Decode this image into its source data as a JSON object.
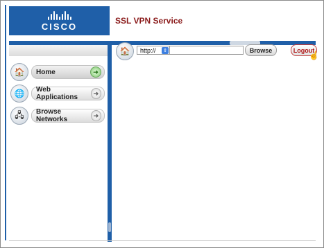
{
  "header": {
    "logo_text": "CISCO",
    "title": "SSL VPN Service"
  },
  "sidebar": {
    "items": [
      {
        "label": "Home",
        "icon": "home-icon",
        "active": true
      },
      {
        "label": "Web Applications",
        "icon": "globe-icon",
        "active": false
      },
      {
        "label": "Browse Networks",
        "icon": "network-icon",
        "active": false
      }
    ]
  },
  "toolbar": {
    "protocol": "http://",
    "url_value": "",
    "browse_label": "Browse",
    "logout_label": "Logout"
  },
  "colors": {
    "brand_blue": "#1f5fa8",
    "title_red": "#8b1c1c",
    "logout_red": "#b01818"
  }
}
